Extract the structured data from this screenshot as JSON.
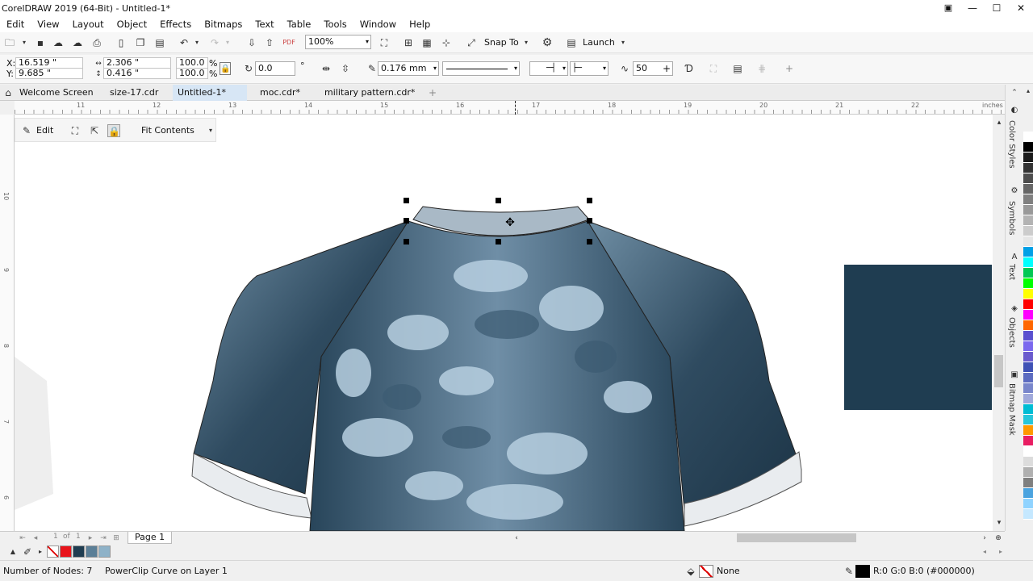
{
  "window": {
    "title": "CorelDRAW 2019 (64-Bit) - Untitled-1*",
    "minimize": "—",
    "maximize": "☐",
    "close": "✕"
  },
  "menu": [
    "Edit",
    "View",
    "Layout",
    "Object",
    "Effects",
    "Bitmaps",
    "Text",
    "Table",
    "Tools",
    "Window",
    "Help"
  ],
  "toolbar": {
    "zoom": "100%",
    "snap_to": "Snap To",
    "launch": "Launch"
  },
  "props": {
    "x_label": "X:",
    "x": "16.519 \"",
    "y_label": "Y:",
    "y": "9.685 \"",
    "width": "2.306 \"",
    "height": "0.416 \"",
    "scale_w": "100.0",
    "scale_h": "100.0",
    "pct": "%",
    "rotation": "0.0",
    "deg": "°",
    "outline_width": "0.176 mm",
    "smoothing": "50"
  },
  "tabs": [
    {
      "label": "Welcome Screen",
      "active": false
    },
    {
      "label": "size-17.cdr",
      "active": false
    },
    {
      "label": "Untitled-1*",
      "active": true
    },
    {
      "label": "moc.cdr*",
      "active": false
    },
    {
      "label": "military pattern.cdr*",
      "active": false
    }
  ],
  "ruler": {
    "h_ticks": [
      "11",
      "12",
      "13",
      "14",
      "15",
      "16",
      "17",
      "18",
      "19",
      "20",
      "21",
      "22"
    ],
    "units": "inches",
    "v_ticks": [
      "10",
      "9",
      "8",
      "7",
      "6"
    ]
  },
  "powerclip_bar": {
    "edit": "Edit",
    "fit": "Fit Contents"
  },
  "page_nav": {
    "current": "1",
    "of": "of",
    "total": "1",
    "page_tab": "Page 1"
  },
  "status": {
    "nodes": "Number of Nodes: 7",
    "object": "PowerClip Curve on Layer 1",
    "fill": "None",
    "outline_color": "R:0 G:0 B:0 (#000000)"
  },
  "dockers": [
    "Color Styles",
    "Symbols",
    "Text",
    "Objects",
    "Bitmap Mask"
  ],
  "colors": {
    "swatch_navy": "#1f3d51",
    "doc_palette": [
      "#ffffff",
      "#e8141b",
      "#1f3d51",
      "#5b7f97",
      "#8eb2c8"
    ],
    "palette": [
      "#ffffff",
      "#000000",
      "#1a1a1a",
      "#333333",
      "#4d4d4d",
      "#666666",
      "#808080",
      "#999999",
      "#b3b3b3",
      "#cccccc",
      "#e6e6e6",
      "#00a0e6",
      "#00ffff",
      "#00c853",
      "#00ff00",
      "#ffff00",
      "#ff0000",
      "#ff00ff",
      "#ff6600",
      "#5a4fcf",
      "#7b68ee",
      "#6a5acd",
      "#3f51b5",
      "#5c6bc0",
      "#7986cb",
      "#9fa8da",
      "#00bcd4",
      "#26c6da",
      "#ff9800",
      "#e91e63",
      "#ffffff",
      "#dcdcdc",
      "#b0b0b0",
      "#7f7f7f",
      "#4aa3df",
      "#8fd3ff",
      "#c5e8ff"
    ]
  }
}
